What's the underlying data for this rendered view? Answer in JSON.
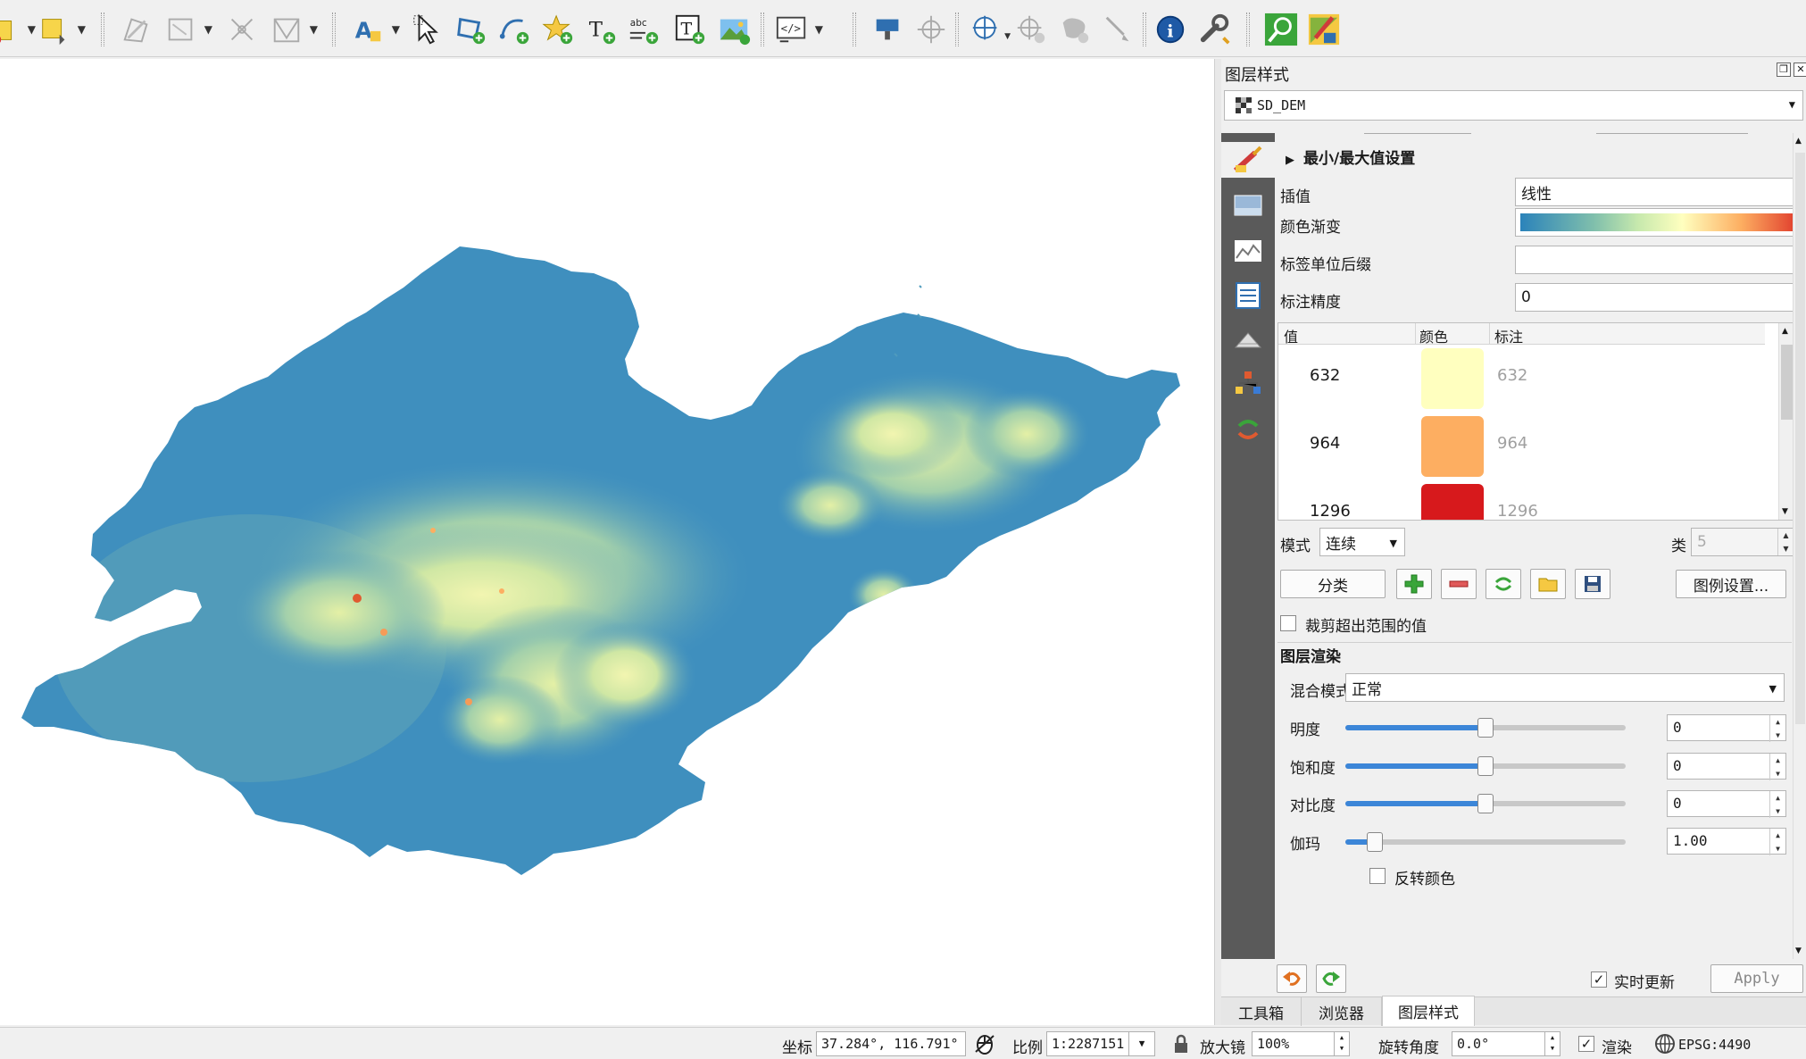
{
  "toolbar": {
    "icons": [
      "select-feature-icon",
      "digitize-icon",
      "edit-geometry-icon",
      "vertex-tool-icon",
      "topology-icon",
      "label-icon",
      "select-label-icon",
      "add-polygon-icon",
      "add-line-icon",
      "add-point-icon",
      "add-text-icon",
      "add-label-icon",
      "add-textbox-icon",
      "add-image-icon",
      "add-html-icon",
      "pin-label-icon",
      "move-label-icon",
      "georeference-icon",
      "add-feature-icon",
      "shape-icon",
      "measure-icon",
      "identify-icon",
      "plugin-tool-icon",
      "search-icon",
      "style-brush-icon"
    ]
  },
  "panel": {
    "title": "图层样式",
    "layer": "SD_DEM",
    "minmax_section": "最小/最大值设置",
    "interpolation_label": "插值",
    "interpolation_value": "线性",
    "ramp_label": "颜色渐变",
    "unit_suffix_label": "标签单位后缀",
    "unit_suffix_value": "",
    "precision_label": "标注精度",
    "precision_value": "0",
    "table_headers": {
      "value": "值",
      "color": "颜色",
      "label": "标注"
    },
    "table_rows": [
      {
        "value": "632",
        "label": "632",
        "color": "#ffffbf"
      },
      {
        "value": "964",
        "label": "964",
        "color": "#fdae61"
      },
      {
        "value": "1296",
        "label": "1296",
        "color": "#d7191c"
      }
    ],
    "mode_label": "模式",
    "mode_value": "连续",
    "classes_label": "类",
    "classes_value": "5",
    "classify_button": "分类",
    "legend_settings_button": "图例设置...",
    "clip_label": "裁剪超出范围的值",
    "render_heading": "图层渲染",
    "blend_label": "混合模式",
    "blend_value": "正常",
    "brightness_label": "明度",
    "brightness_value": "0",
    "saturation_label": "饱和度",
    "saturation_value": "0",
    "contrast_label": "对比度",
    "contrast_value": "0",
    "gamma_label": "伽玛",
    "gamma_value": "1.00",
    "invert_label": "反转颜色",
    "live_update_label": "实时更新",
    "apply_button": "Apply"
  },
  "tabs": [
    "工具箱",
    "浏览器",
    "图层样式"
  ],
  "status": {
    "coord_label": "坐标",
    "coord_value": "37.284°, 116.791°",
    "scale_label": "比例",
    "scale_value": "1:2287151",
    "magnifier_label": "放大镜",
    "magnifier_value": "100%",
    "rotation_label": "旋转角度",
    "rotation_value": "0.0°",
    "render_label": "渲染",
    "crs": "EPSG:4490"
  }
}
